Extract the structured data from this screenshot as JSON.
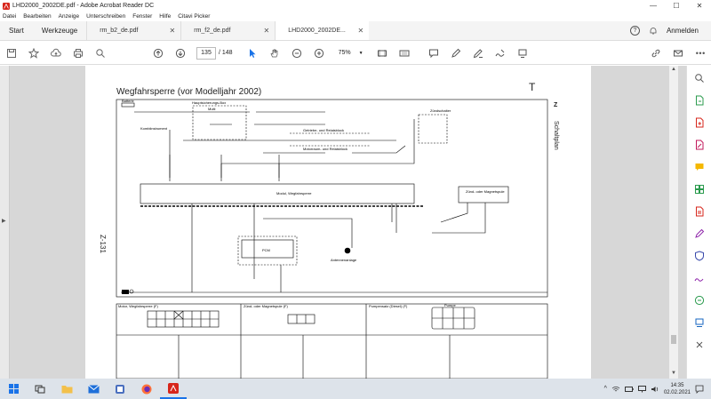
{
  "window": {
    "title": "LHD2000_2002DE.pdf - Adobe Acrobat Reader DC",
    "min": "—",
    "max": "☐",
    "close": "✕"
  },
  "menu": [
    "Datei",
    "Bearbeiten",
    "Anzeige",
    "Unterschreiben",
    "Fenster",
    "Hilfe",
    "Citavi Picker"
  ],
  "tabs": {
    "home": "Start",
    "tools": "Werkzeuge",
    "docs": [
      {
        "label": "rm_b2_de.pdf"
      },
      {
        "label": "rm_f2_de.pdf"
      },
      {
        "label": "LHD2000_2002DE..."
      }
    ],
    "close_glyph": "✕",
    "help": "?",
    "login": "Anmelden"
  },
  "toolbar": {
    "page_current": "135",
    "page_total": "/ 148",
    "zoom": "75%"
  },
  "diagram": {
    "title": "Wegfahrsperre (vor Modelljahr 2002)",
    "corner_letter": "T",
    "section_letter": "Z",
    "section_name": "Schaltplan",
    "page_code": "Z-131",
    "labels": {
      "batterie": "Batterie",
      "hauptsicherung": "Hauptsicherungs-Box",
      "multi": "Multi",
      "instr": "Kombiinstrument",
      "zuendschalter": "Zündschalter",
      "getriebe": "Getriebe- und Relaisblock",
      "motorraum": "Motorraum- und Relaisblock",
      "modul": "Modul, Wegfahrsperre",
      "zuendmagnet": "Zünd- oder Magnetspule",
      "pcm": "PCM",
      "antenne": "Antennenanlage",
      "conn1": "Motor, Wegfahrsperre (F)",
      "conn2": "Zünd- oder Magnetspule (F)",
      "conn3": "Pumpensatz (Diesel) (F)",
      "conn4": "Pumpe"
    }
  },
  "taskbar": {
    "time": "14:35",
    "date": "02.02.2021"
  }
}
